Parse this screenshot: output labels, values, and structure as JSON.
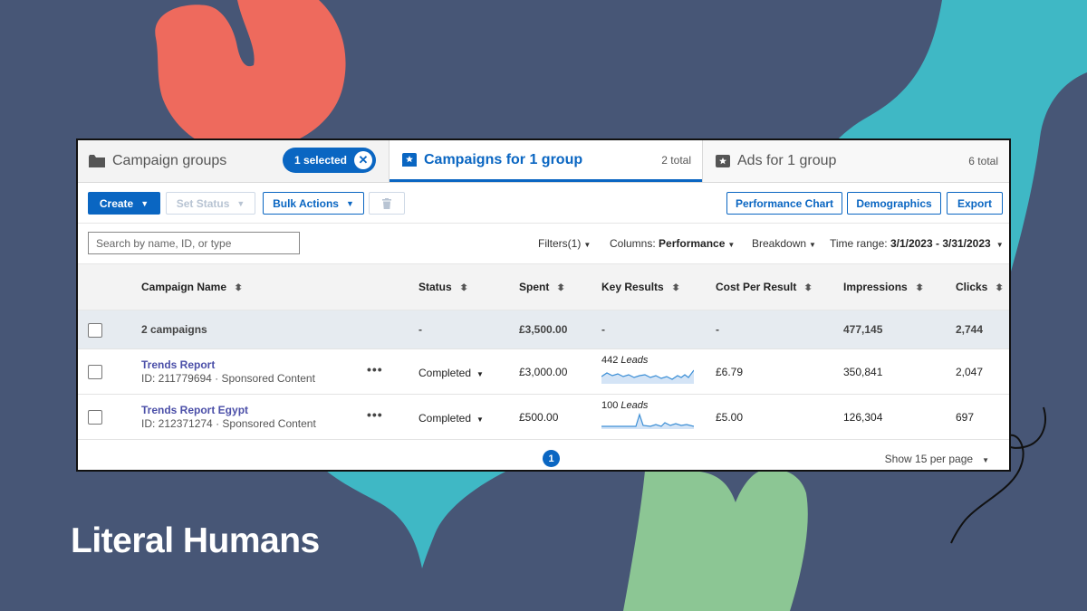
{
  "brand": "Literal Humans",
  "tabs": {
    "groups_label": "Campaign groups",
    "selected_label": "1 selected",
    "campaigns_label": "Campaigns for 1 group",
    "campaigns_count": "2 total",
    "ads_label": "Ads for 1 group",
    "ads_count": "6 total"
  },
  "toolbar": {
    "create": "Create",
    "set_status": "Set Status",
    "bulk_actions": "Bulk Actions",
    "performance_chart": "Performance Chart",
    "demographics": "Demographics",
    "export": "Export"
  },
  "filters": {
    "search_placeholder": "Search by name, ID, or type",
    "filters": "Filters(1)",
    "columns_label": "Columns:",
    "columns_value": "Performance",
    "breakdown": "Breakdown",
    "time_range_label": "Time range:",
    "time_range_value": "3/1/2023 - 3/31/2023"
  },
  "table": {
    "headers": {
      "name": "Campaign Name",
      "status": "Status",
      "spent": "Spent",
      "key_results": "Key Results",
      "cpr": "Cost Per Result",
      "impressions": "Impressions",
      "clicks": "Clicks"
    },
    "total": {
      "label": "2 campaigns",
      "status": "-",
      "spent": "£3,500.00",
      "key_results": "-",
      "cpr": "-",
      "impressions": "477,145",
      "clicks": "2,744"
    },
    "rows": [
      {
        "name": "Trends Report",
        "meta": "ID: 211779694 · Sponsored Content",
        "status": "Completed",
        "spent": "£3,000.00",
        "leads_count": "442",
        "leads_word": "Leads",
        "cpr": "£6.79",
        "impressions": "350,841",
        "clicks": "2,047"
      },
      {
        "name": "Trends Report Egypt",
        "meta": "ID: 212371274 · Sponsored Content",
        "status": "Completed",
        "spent": "£500.00",
        "leads_count": "100",
        "leads_word": "Leads",
        "cpr": "£5.00",
        "impressions": "126,304",
        "clicks": "697"
      }
    ]
  },
  "footer": {
    "page": "1",
    "per_page": "Show 15 per page"
  },
  "colors": {
    "background": "#475676",
    "accent": "#0a66c2",
    "campaign_link": "#4b4fa8",
    "shape_red": "#ee6a5d",
    "shape_teal": "#3fb8c5",
    "shape_green": "#8cc694"
  },
  "icons": {
    "groups": "folder-icon",
    "campaigns": "campaign-star-icon",
    "ads": "ad-star-icon",
    "delete": "trash-icon",
    "sort": "sort-icon",
    "more": "more-dots-icon"
  }
}
